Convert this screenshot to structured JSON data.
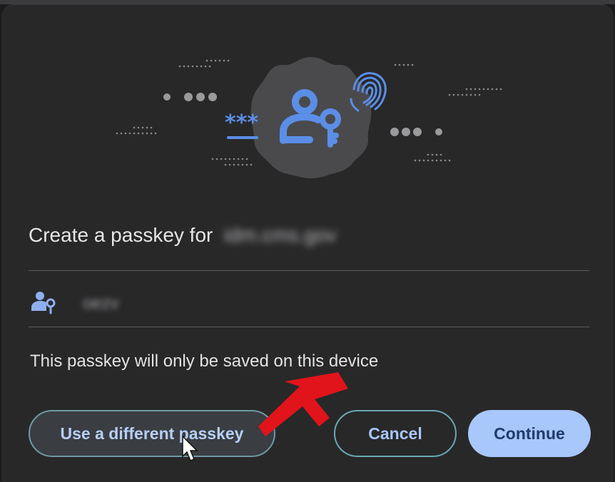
{
  "dialog": {
    "title_prefix": "Create a passkey for",
    "site": "idm.cms.gov",
    "username": "oezv",
    "note": "This passkey will only be saved on this device"
  },
  "buttons": {
    "different": "Use a different passkey",
    "cancel": "Cancel",
    "continue": "Continue"
  },
  "icons": {
    "hero": "passkey-illustration-icon",
    "account": "person-key-icon",
    "annotation": "red-arrow-icon",
    "cursor": "mouse-pointer-icon"
  },
  "colors": {
    "accent": "#a8c7fa",
    "icon_blue": "#5b8ee6",
    "annotation": "#e0141a"
  }
}
